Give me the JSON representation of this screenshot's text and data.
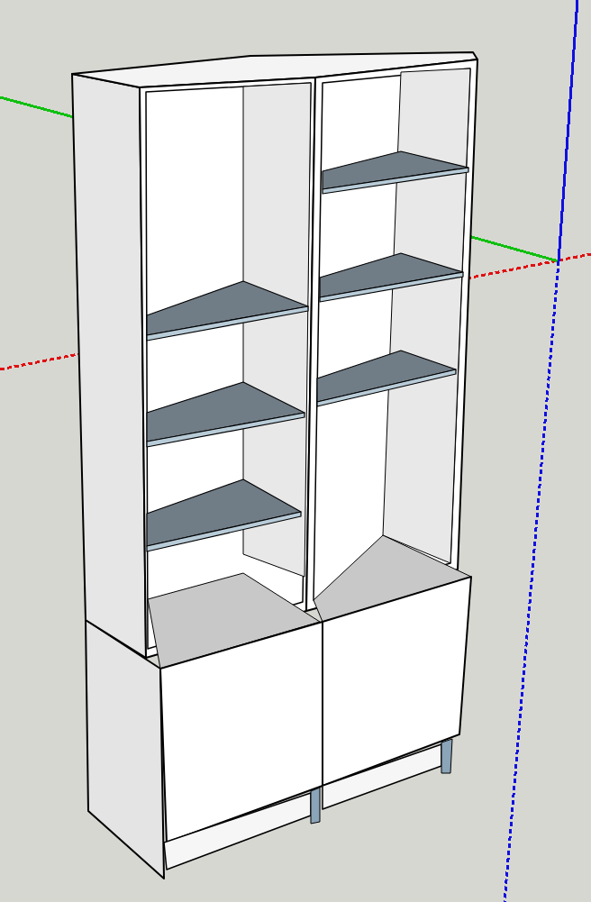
{
  "viewport": {
    "axes": [
      {
        "color": "#e01010"
      },
      {
        "color": "#10c010"
      },
      {
        "color": "#1010e0"
      }
    ]
  }
}
